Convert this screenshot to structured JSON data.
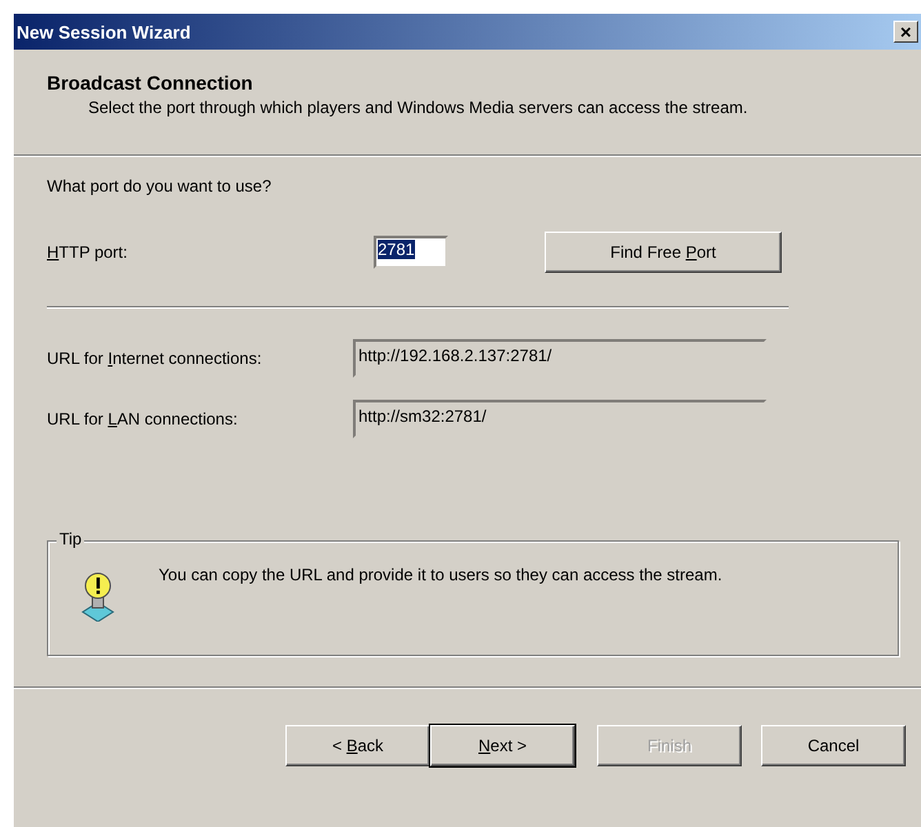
{
  "window": {
    "title": "New Session Wizard",
    "close": "×"
  },
  "header": {
    "title": "Broadcast Connection",
    "subtitle": "Select the port through which players and Windows Media servers can access the stream."
  },
  "question": "What port do you want to use?",
  "http_port": {
    "label": {
      "key": "H",
      "post": "TTP port:"
    },
    "value": "2781",
    "selected": true
  },
  "find_button": {
    "pre": "Find Free ",
    "key": "P",
    "post": "ort"
  },
  "urls": [
    {
      "label": {
        "pre": "URL for ",
        "key": "I",
        "post": "nternet connections:"
      },
      "value": "http://192.168.2.137:2781/"
    },
    {
      "label": {
        "pre": "URL for ",
        "key": "L",
        "post": "AN connections:"
      },
      "value": "http://sm32:2781/"
    }
  ],
  "tip": {
    "legend": "Tip",
    "text": "You can copy the URL and provide it to users so they can access the stream."
  },
  "buttons": [
    {
      "pre": "< ",
      "key": "B",
      "post": "ack",
      "disabled": false,
      "default": false
    },
    {
      "key": "N",
      "post": "ext >",
      "disabled": false,
      "default": true
    },
    {
      "post": "Finish",
      "disabled": true,
      "default": false
    },
    {
      "post": "Cancel",
      "disabled": false,
      "default": false
    }
  ]
}
